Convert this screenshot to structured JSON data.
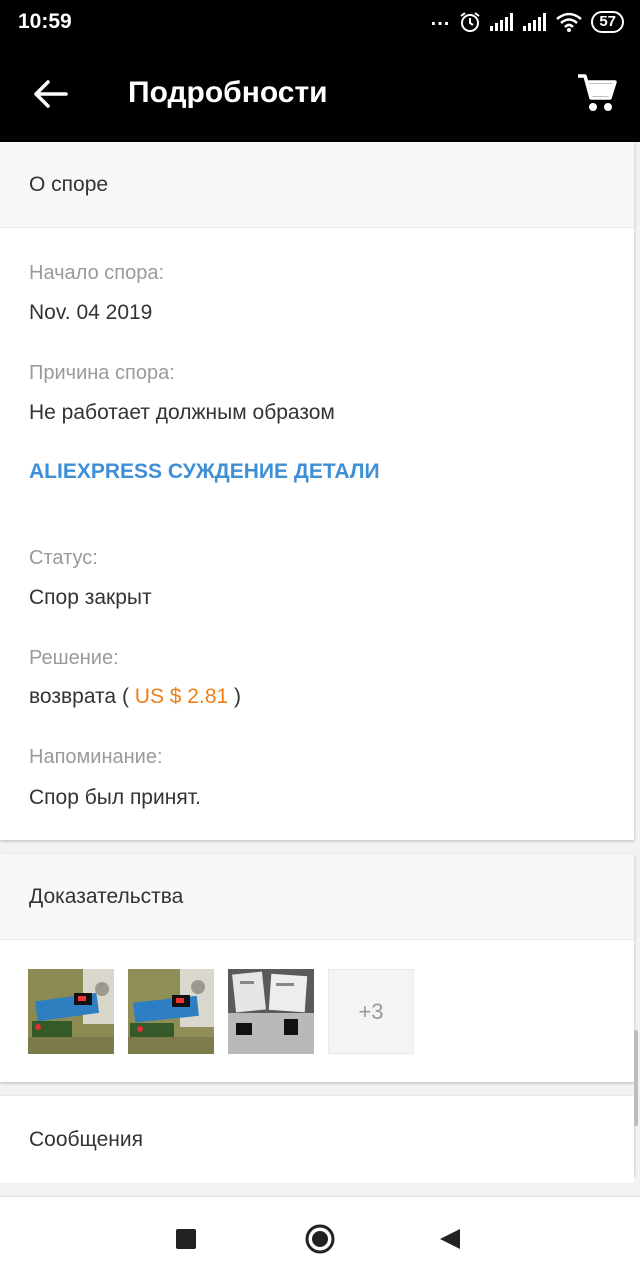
{
  "status_bar": {
    "time": "10:59",
    "dots": "...",
    "battery": "57"
  },
  "toolbar": {
    "title": "Подробности",
    "back_icon": "arrow-left-icon",
    "cart_icon": "shopping-cart-icon"
  },
  "dispute": {
    "header": "О споре",
    "start_label": "Начало спора:",
    "start_value": "Nov. 04 2019",
    "reason_label": "Причина спора:",
    "reason_value": "Не работает должным образом",
    "details_link": "ALIEXPRESS СУЖДЕНИЕ ДЕТАЛИ",
    "status_label": "Статус:",
    "status_value": "Спор закрыт",
    "decision_label": "Решение:",
    "decision_prefix": "возврата (",
    "decision_amount": "US $ 2.81",
    "decision_suffix": ")",
    "reminder_label": "Напоминание:",
    "reminder_value": "Спор был принят."
  },
  "evidence": {
    "header": "Доказательства",
    "more_count": "+3"
  },
  "messages": {
    "header": "Сообщения"
  },
  "colors": {
    "accent_link": "#3f8fd6",
    "price": "#f07f1a",
    "toolbar_bg": "#000000"
  }
}
